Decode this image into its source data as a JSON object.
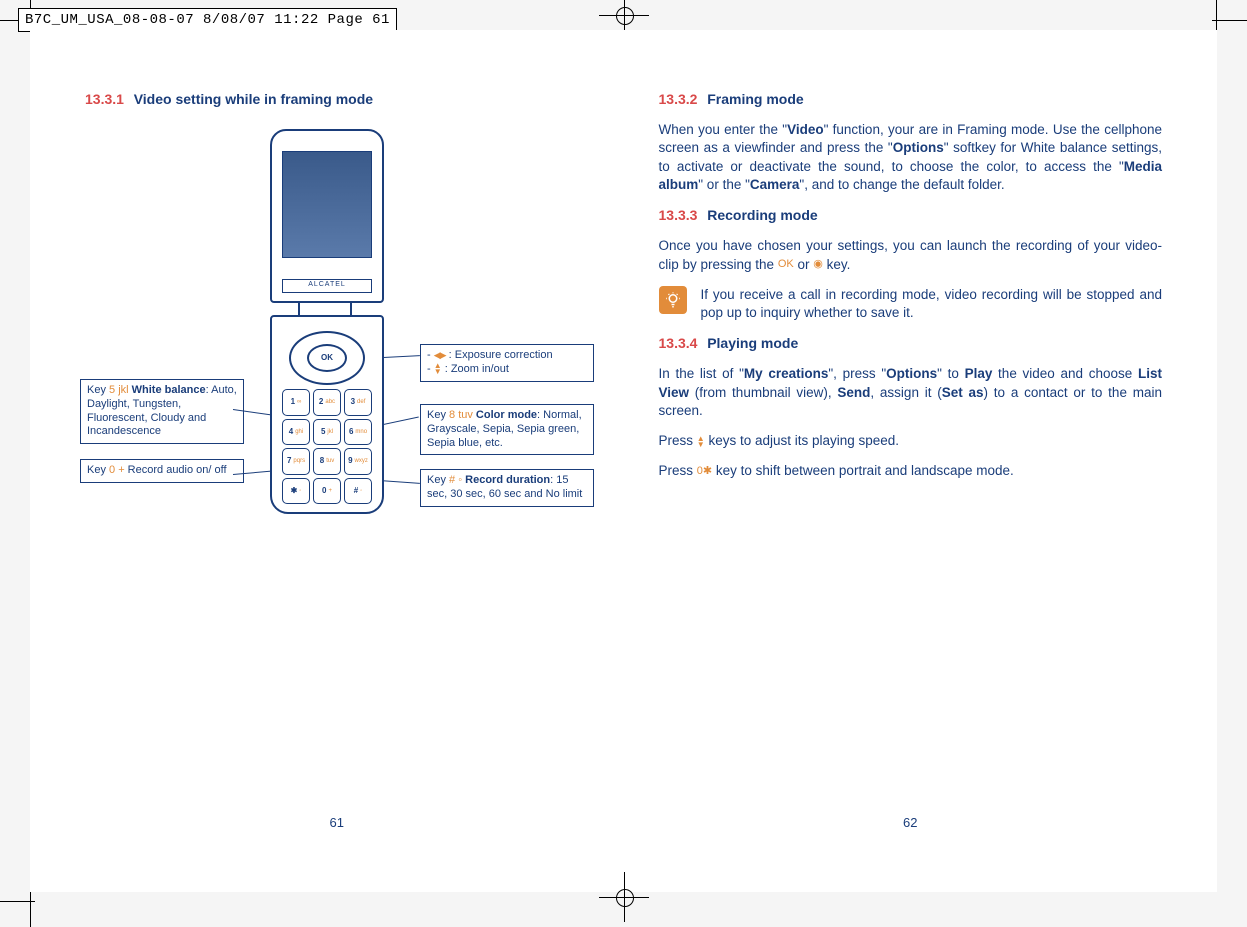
{
  "print_header": "B7C_UM_USA_08-08-07  8/08/07  11:22  Page 61",
  "left": {
    "sec_num": "13.3.1",
    "sec_title": "Video setting while in framing mode",
    "page_num": "61",
    "phone_brand": "ALCATEL",
    "ok_label": "OK",
    "keys": [
      {
        "main": "1",
        "sub": "∞"
      },
      {
        "main": "2",
        "sub": "abc"
      },
      {
        "main": "3",
        "sub": "def"
      },
      {
        "main": "4",
        "sub": "ghi"
      },
      {
        "main": "5",
        "sub": "jkl"
      },
      {
        "main": "6",
        "sub": "mno"
      },
      {
        "main": "7",
        "sub": "pqrs"
      },
      {
        "main": "8",
        "sub": "tuv"
      },
      {
        "main": "9",
        "sub": "wxyz"
      },
      {
        "main": "✱",
        "sub": "◦"
      },
      {
        "main": "0",
        "sub": "+"
      },
      {
        "main": "#",
        "sub": "◦"
      }
    ],
    "callouts": {
      "white_balance_pre": "Key ",
      "white_balance_key": "5 jkl",
      "white_balance_bold": " White balance",
      "white_balance_post": ": Auto, Daylight, Tungsten, Fluorescent, Cloudy and Incandescence",
      "record_audio_pre": "Key ",
      "record_audio_key": "0 +",
      "record_audio_post": " Record audio on/ off",
      "exposure_line1": "- ",
      "exposure_line1_post": " : Exposure correction",
      "exposure_line2": "- ",
      "exposure_line2_post": " : Zoom in/out",
      "color_mode_pre": "Key ",
      "color_mode_key": "8 tuv",
      "color_mode_bold": " Color mode",
      "color_mode_post": ": Normal, Grayscale, Sepia, Sepia green, Sepia blue, etc.",
      "record_dur_pre": "Key ",
      "record_dur_key": "# ◦",
      "record_dur_bold": " Record duration",
      "record_dur_post": ": 15 sec, 30 sec, 60 sec and No limit"
    }
  },
  "right": {
    "s2_num": "13.3.2",
    "s2_title": "Framing mode",
    "s2_p1a": "When you enter the \"",
    "s2_p1b": "Video",
    "s2_p1c": "\" function, your are in Framing mode. Use the cellphone screen as a viewfinder and press the \"",
    "s2_p1d": "Options",
    "s2_p1e": "\" softkey for White balance settings, to activate or deactivate the sound, to choose the color, to access the \"",
    "s2_p1f": "Media album",
    "s2_p1g": "\" or the \"",
    "s2_p1h": "Camera",
    "s2_p1i": "\", and to change the default folder.",
    "s3_num": "13.3.3",
    "s3_title": "Recording mode",
    "s3_p1a": "Once you have chosen your settings, you can launch the recording of your video-clip by pressing the ",
    "s3_p1b": " or ",
    "s3_p1c": " key.",
    "tip_text": "If you receive a call in recording mode, video recording will be stopped and pop up to inquiry whether to save it.",
    "s4_num": "13.3.4",
    "s4_title": "Playing mode",
    "s4_p1a": "In the list of \"",
    "s4_p1b": "My creations",
    "s4_p1c": "\", press \"",
    "s4_p1d": "Options",
    "s4_p1e": "\" to ",
    "s4_p1f": "Play",
    "s4_p1g": " the video and choose ",
    "s4_p1h": "List View",
    "s4_p1i": " (from thumbnail view), ",
    "s4_p1j": "Send",
    "s4_p1k": ", assign it (",
    "s4_p1l": "Set as",
    "s4_p1m": ") to a contact or to the main screen.",
    "s4_p2a": "Press ",
    "s4_p2b": " keys to adjust its playing speed.",
    "s4_p3a": "Press ",
    "s4_p3b": " key to shift between portrait and landscape mode.",
    "page_num": "62"
  }
}
